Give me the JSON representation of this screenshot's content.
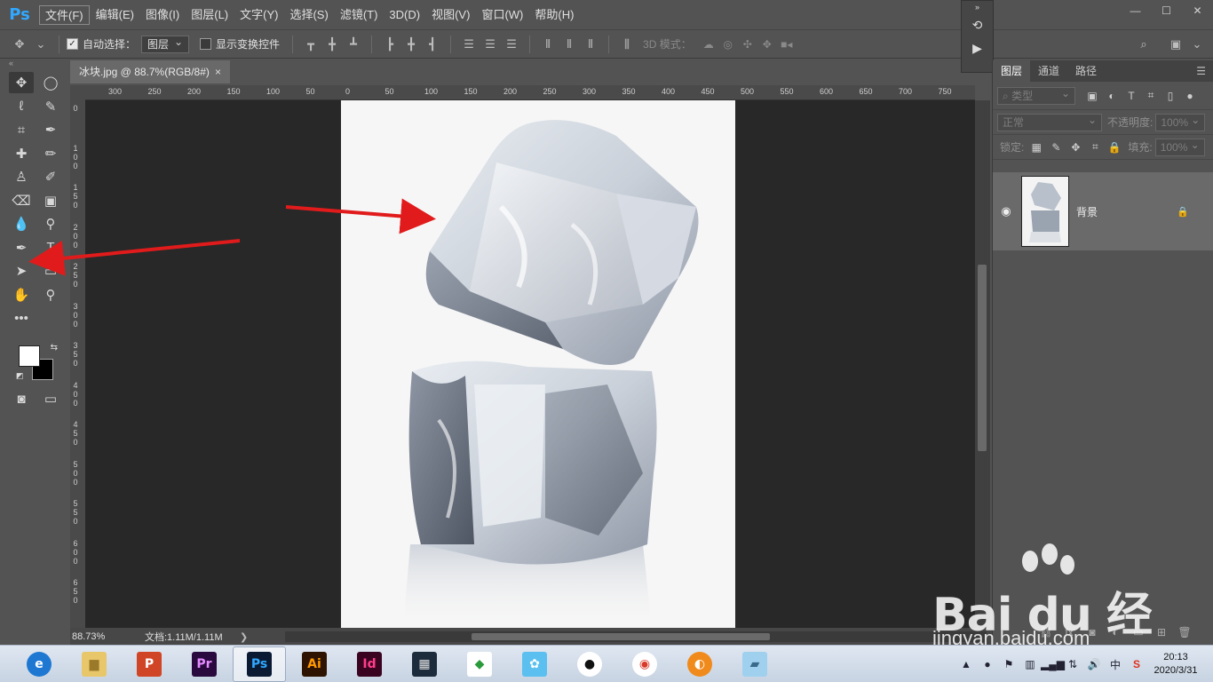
{
  "app": {
    "logo": "Ps",
    "accent": "#31a8ff"
  },
  "menu": [
    "文件(F)",
    "编辑(E)",
    "图像(I)",
    "图层(L)",
    "文字(Y)",
    "选择(S)",
    "滤镜(T)",
    "3D(D)",
    "视图(V)",
    "窗口(W)",
    "帮助(H)"
  ],
  "window_controls": {
    "minimize": "—",
    "maximize": "☐",
    "close": "✕"
  },
  "options": {
    "auto_select_checked": true,
    "auto_select_label": "自动选择：",
    "auto_select_target": "图层",
    "show_transform_label": "显示变换控件",
    "show_transform_checked": false,
    "mode_3d_label": "3D 模式："
  },
  "document": {
    "tab_title": "冰块.jpg @ 88.7%(RGB/8#)",
    "close": "×"
  },
  "ruler": {
    "top": [
      "300",
      "250",
      "200",
      "150",
      "100",
      "50",
      "0",
      "50",
      "100",
      "150",
      "200",
      "250",
      "300",
      "350",
      "400",
      "450",
      "500",
      "550",
      "600",
      "650",
      "700",
      "750"
    ],
    "left": [
      "0",
      "100",
      "150",
      "200",
      "250",
      "300",
      "350",
      "400",
      "450",
      "500",
      "550",
      "600",
      "650"
    ]
  },
  "status": {
    "zoom": "88.73%",
    "doc_size": "文档:1.11M/1.11M",
    "arrow": "❯"
  },
  "layers_panel": {
    "tabs": [
      "图层",
      "通道",
      "路径"
    ],
    "filter_kind": "类型",
    "blend_mode": "正常",
    "opacity_label": "不透明度:",
    "opacity_value": "100%",
    "lock_label": "锁定:",
    "fill_label": "填充:",
    "fill_value": "100%",
    "layer_name": "背景"
  },
  "taskbar": {
    "apps": [
      {
        "name": "ie",
        "label": "e",
        "bg": "#1e78d2",
        "fg": "#ffffff"
      },
      {
        "name": "explorer",
        "label": "▆",
        "bg": "#e8c66a",
        "fg": "#9a7a2a"
      },
      {
        "name": "powerpoint",
        "label": "P",
        "bg": "#d04525",
        "fg": "#ffffff"
      },
      {
        "name": "premiere",
        "label": "Pr",
        "bg": "#2a0a3e",
        "fg": "#e58cff"
      },
      {
        "name": "photoshop",
        "label": "Ps",
        "bg": "#0a1a33",
        "fg": "#31a8ff"
      },
      {
        "name": "illustrator",
        "label": "Ai",
        "bg": "#2e1300",
        "fg": "#ff9a00"
      },
      {
        "name": "indesign",
        "label": "Id",
        "bg": "#3a0420",
        "fg": "#ff3d8b"
      },
      {
        "name": "video-editor",
        "label": "▦",
        "bg": "#1c2c3c",
        "fg": "#e0e0e0"
      },
      {
        "name": "color-app",
        "label": "◆",
        "bg": "#ffffff",
        "fg": "#2a9a3a"
      },
      {
        "name": "chat-app",
        "label": "✿",
        "bg": "#5bc0f0",
        "fg": "#ffffff"
      },
      {
        "name": "qq",
        "label": "●",
        "bg": "#ffffff",
        "fg": "#111111"
      },
      {
        "name": "chrome",
        "label": "◉",
        "bg": "#ffffff",
        "fg": "#d83b2b"
      },
      {
        "name": "browser",
        "label": "◐",
        "bg": "#f08a1c",
        "fg": "#ffffff"
      },
      {
        "name": "notes",
        "label": "▰",
        "bg": "#9fd0ee",
        "fg": "#3a6a8a"
      }
    ],
    "input_method": "中",
    "time": "20:13",
    "date": "2020/3/31"
  },
  "watermark": {
    "brand": "Bai du 经验",
    "url": "jingyan.baidu.com"
  }
}
